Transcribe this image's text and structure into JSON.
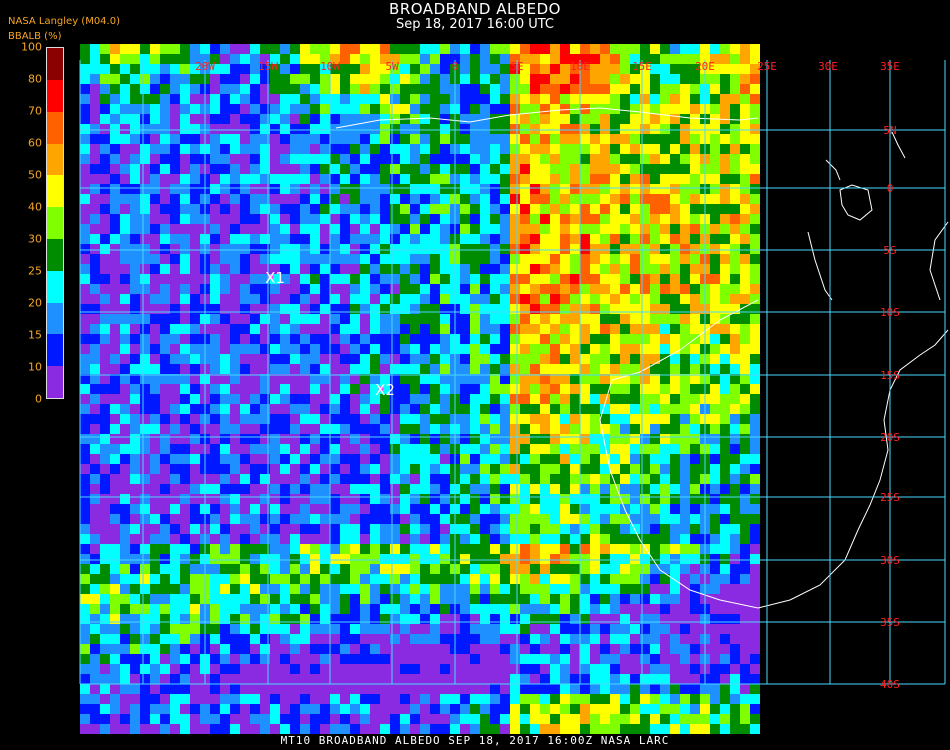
{
  "header": {
    "title": "BROADBAND ALBEDO",
    "subtitle": "Sep 18, 2017 16:00 UTC",
    "source": "NASA Langley (M04.0)"
  },
  "legend": {
    "label": "BBALB (%)",
    "ticks": [
      "0",
      "10",
      "15",
      "20",
      "25",
      "30",
      "40",
      "50",
      "60",
      "70",
      "80",
      "100"
    ],
    "colors": [
      "#8a2be2",
      "#0018ff",
      "#1e90ff",
      "#00ffff",
      "#008c00",
      "#80ff00",
      "#ffff00",
      "#ffa500",
      "#ff6000",
      "#ff0000",
      "#8b0000"
    ]
  },
  "map": {
    "lon_labels": [
      "20W",
      "15W",
      "10W",
      "5W",
      "0",
      "5E",
      "10E",
      "15E",
      "20E",
      "25E",
      "30E",
      "35E"
    ],
    "lat_labels": [
      "5N",
      "0",
      "5S",
      "10S",
      "15S",
      "20S",
      "25S",
      "30S",
      "35S",
      "40S"
    ],
    "markers": [
      {
        "label": "X1"
      },
      {
        "label": "X2"
      }
    ],
    "grid_color": "#4ad9ff",
    "label_color": "#ff2020",
    "coast_color": "#ffffff"
  },
  "footer": "MT10  BROADBAND ALBEDO   SEP 18, 2017 16:00Z   NASA LARC"
}
